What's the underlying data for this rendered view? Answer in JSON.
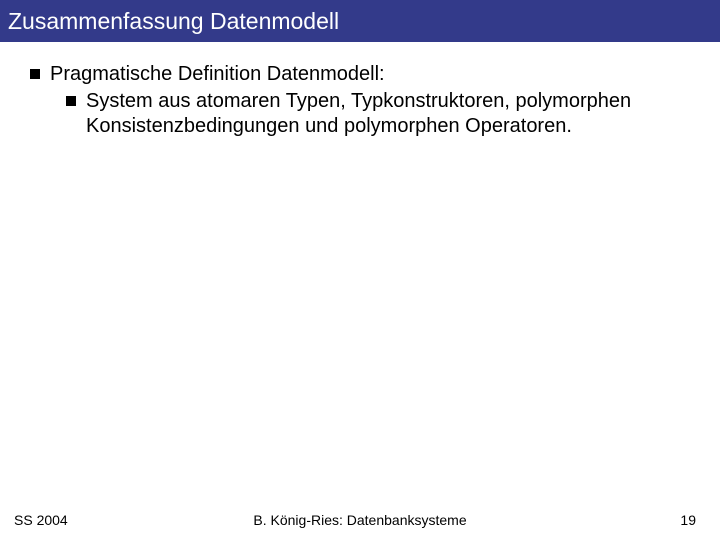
{
  "slide": {
    "title": "Zusammenfassung Datenmodell",
    "bullets": {
      "l1": "Pragmatische Definition Datenmodell:",
      "l2": "System aus atomaren Typen, Typkonstruktoren, polymorphen Konsistenzbedingungen und polymorphen Operatoren."
    }
  },
  "footer": {
    "left": "SS 2004",
    "center": "B. König-Ries: Datenbanksysteme",
    "right": "19"
  }
}
